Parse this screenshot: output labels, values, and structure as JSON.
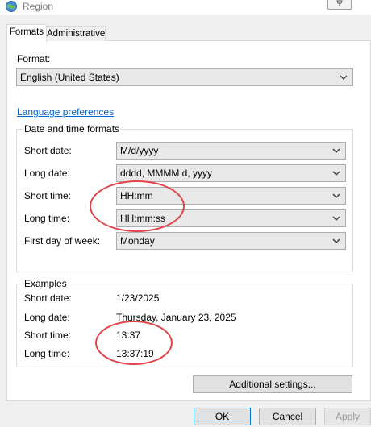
{
  "window": {
    "title": "Region"
  },
  "tabs": [
    {
      "label": "Formats",
      "active": true
    },
    {
      "label": "Administrative",
      "active": false
    }
  ],
  "format": {
    "label": "Format:",
    "value": "English (United States)"
  },
  "language_link": "Language preferences",
  "date_time": {
    "group_title": "Date and time formats",
    "rows": [
      {
        "label": "Short date:",
        "value": "M/d/yyyy"
      },
      {
        "label": "Long date:",
        "value": "dddd, MMMM d, yyyy"
      },
      {
        "label": "Short time:",
        "value": "HH:mm"
      },
      {
        "label": "Long time:",
        "value": "HH:mm:ss"
      },
      {
        "label": "First day of week:",
        "value": "Monday"
      }
    ]
  },
  "examples": {
    "group_title": "Examples",
    "rows": [
      {
        "label": "Short date:",
        "value": "1/23/2025"
      },
      {
        "label": "Long date:",
        "value": "Thursday, January 23, 2025"
      },
      {
        "label": "Short time:",
        "value": "13:37"
      },
      {
        "label": "Long time:",
        "value": "13:37:19"
      }
    ]
  },
  "buttons": {
    "additional": "Additional settings...",
    "ok": "OK",
    "cancel": "Cancel",
    "apply": "Apply"
  },
  "colors": {
    "link": "#0066cc",
    "highlight_ring": "#e0454a"
  }
}
